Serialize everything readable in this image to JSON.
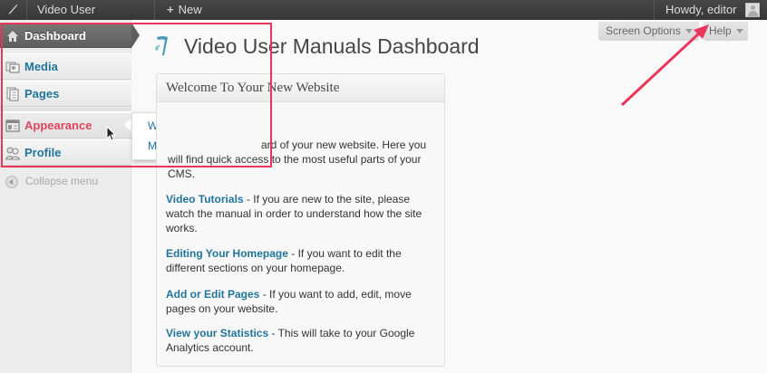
{
  "admin_bar": {
    "logo": "⟋",
    "site_name": "Video User Manuals",
    "new_label": "New",
    "new_icon": "plus-icon",
    "account_greeting": "Howdy, editor"
  },
  "sidebar": {
    "items": [
      {
        "label": "Dashboard",
        "icon": "home-icon"
      },
      {
        "label": "Media",
        "icon": "media-icon"
      },
      {
        "label": "Pages",
        "icon": "pages-icon"
      },
      {
        "label": "Appearance",
        "icon": "appearance-icon"
      },
      {
        "label": "Profile",
        "icon": "profile-icon"
      }
    ],
    "collapse_label": "Collapse menu"
  },
  "submenu": {
    "items": [
      "Widgets",
      "Menus"
    ]
  },
  "header": {
    "screen_options": "Screen Options",
    "help": "Help",
    "page_title": "Video User Manuals Dashboard"
  },
  "welcome": {
    "title": "Welcome To Your New Website",
    "intro": "ard of your new website. Here you will find quick access to the most useful parts of your CMS.",
    "video_link": "Video Tutorials",
    "video_text": " - If you are new to the site, please watch the manual in order to understand how the site works.",
    "edit_link": "Editing Your Homepage",
    "edit_text": " - If you want to edit the different sections on your homepage.",
    "pages_link": "Add or Edit Pages",
    "pages_text": " - If you want to add, edit, move pages on your website.",
    "stats_link": "View your Statistics",
    "stats_text": " - This will take to your Google Analytics account."
  },
  "colors": {
    "highlight": "#e8365b",
    "link": "#21759b",
    "active_menu": "#e0435d"
  }
}
